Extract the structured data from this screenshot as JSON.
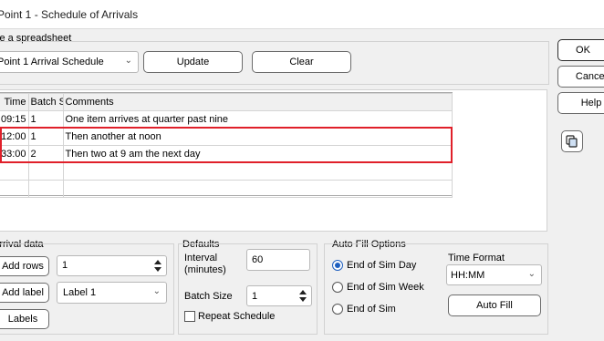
{
  "window": {
    "title": "Point 1 - Schedule of Arrivals"
  },
  "spreadsheet": {
    "label": "Use a spreadsheet",
    "selected": "Point 1 Arrival Schedule",
    "update_label": "Update",
    "clear_label": "Clear"
  },
  "dialog_buttons": {
    "ok": "OK",
    "cancel": "Cancel",
    "help": "Help"
  },
  "copy_icon": "copy-icon",
  "table": {
    "columns": [
      "Time",
      "Batch Size",
      "Comments"
    ],
    "rows": [
      {
        "time": "09:15",
        "batch": "1",
        "comment": "One item arrives at quarter past nine"
      },
      {
        "time": "12:00",
        "batch": "1",
        "comment": "Then another at noon"
      },
      {
        "time": "33:00",
        "batch": "2",
        "comment": "Then two at 9 am the next day"
      },
      {
        "time": "",
        "batch": "",
        "comment": ""
      },
      {
        "time": "",
        "batch": "",
        "comment": ""
      }
    ]
  },
  "arrival_data": {
    "label": "Arrival data",
    "add_rows_label": "Add rows",
    "add_rows_value": "1",
    "add_label_label": "Add label",
    "label_select": "Label 1",
    "labels_label": "Labels"
  },
  "defaults": {
    "label": "Defaults",
    "interval_label": "Interval\n(minutes)",
    "interval_value": "60",
    "batch_size_label": "Batch Size",
    "batch_size_value": "1",
    "repeat_label": "Repeat Schedule",
    "repeat_checked": false
  },
  "auto_fill": {
    "label": "Auto Fill Options",
    "options": [
      "End of Sim Day",
      "End of Sim Week",
      "End of Sim"
    ],
    "selected_index": 0,
    "time_format_label": "Time Format",
    "time_format_value": "HH:MM",
    "auto_fill_label": "Auto Fill"
  },
  "colors": {
    "highlight": "#e0202a",
    "radio_accent": "#1e5fbf"
  }
}
